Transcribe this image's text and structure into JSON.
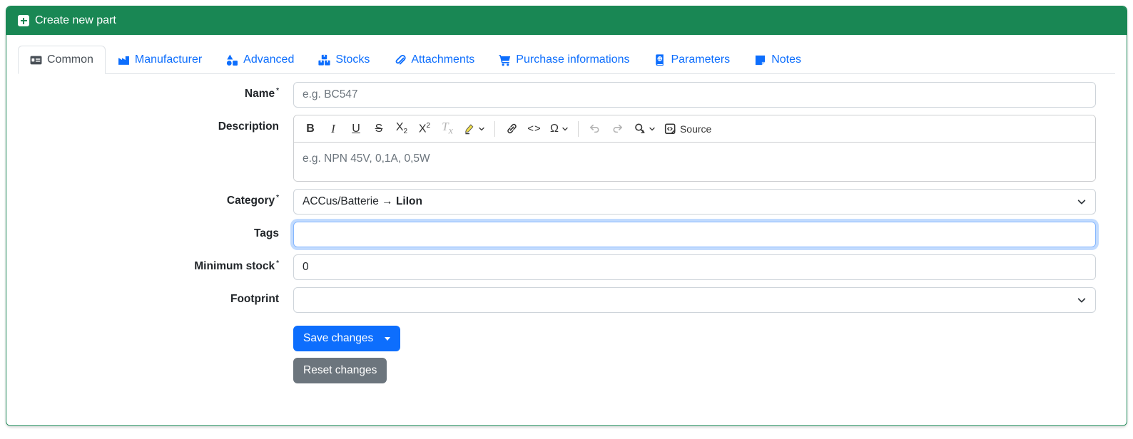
{
  "header": {
    "title": "Create new part",
    "icon": "square-plus-icon",
    "bg_color": "#198754"
  },
  "tabs": [
    {
      "label": "Common",
      "icon": "id-card-icon",
      "active": true
    },
    {
      "label": "Manufacturer",
      "icon": "factory-icon",
      "active": false
    },
    {
      "label": "Advanced",
      "icon": "shapes-icon",
      "active": false
    },
    {
      "label": "Stocks",
      "icon": "boxes-icon",
      "active": false
    },
    {
      "label": "Attachments",
      "icon": "paperclip-icon",
      "active": false
    },
    {
      "label": "Purchase informations",
      "icon": "cart-icon",
      "active": false
    },
    {
      "label": "Parameters",
      "icon": "atlas-icon",
      "active": false
    },
    {
      "label": "Notes",
      "icon": "note-icon",
      "active": false
    }
  ],
  "form": {
    "name": {
      "label": "Name",
      "required": "*",
      "placeholder": "e.g. BC547",
      "value": ""
    },
    "description": {
      "label": "Description",
      "placeholder": "e.g. NPN 45V, 0,1A, 0,5W"
    },
    "category": {
      "label": "Category",
      "required": "*",
      "value_parent": "ACCus/Batterie → ",
      "value_selected": "LiIon"
    },
    "tags": {
      "label": "Tags",
      "value": "",
      "focused": true
    },
    "minimum_stock": {
      "label": "Minimum stock",
      "required": "*",
      "value": "0"
    },
    "footprint": {
      "label": "Footprint",
      "value": ""
    }
  },
  "editor_toolbar": {
    "bold": "B",
    "italic": "I",
    "underline": "U",
    "strikethrough": "S",
    "subscript_main": "X",
    "subscript_sub": "2",
    "superscript_main": "X",
    "superscript_sup": "2",
    "remove_format_main": "T",
    "remove_format_sub": "x",
    "code": "<>",
    "special_char": "Ω",
    "source_label": "Source"
  },
  "buttons": {
    "save": "Save changes",
    "reset": "Reset changes"
  },
  "colors": {
    "success": "#198754",
    "accent": "#0d6efd",
    "secondary": "#6c757d",
    "tab_active_text": "#495057",
    "input_border": "#ced4da",
    "focus_border": "#86b7fe",
    "placeholder": "#6c757d",
    "marker_yellow": "#f3e049"
  }
}
